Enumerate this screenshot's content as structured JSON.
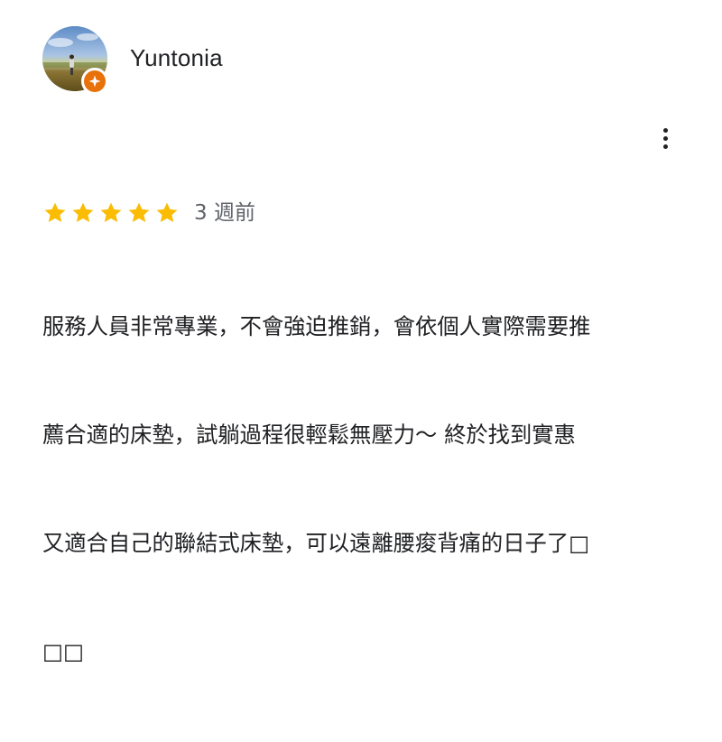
{
  "reviewer": {
    "name": "Yuntonia",
    "avatar_icon": "reviewer-photo",
    "badge_icon": "local-guide-star-icon",
    "badge_color": "#e8710a"
  },
  "menu": {
    "icon": "more-vertical-icon"
  },
  "review": {
    "rating": 5,
    "rating_max": 5,
    "star_color": "#fbbc04",
    "date": "3 週前",
    "lines": [
      "服務人員非常專業，不會強迫推銷，會依個人實際需要推",
      "薦合適的床墊，試躺過程很輕鬆無壓力～ 終於找到實惠",
      "又適合自己的聯結式床墊，可以遠離腰痠背痛的日子了□",
      "□□"
    ]
  }
}
